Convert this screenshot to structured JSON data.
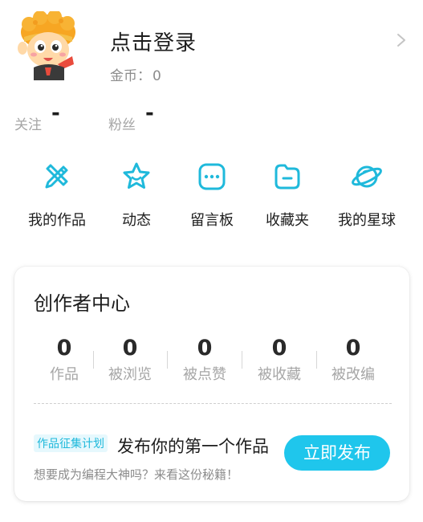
{
  "profile": {
    "login_text": "点击登录",
    "coins_label": "金币：",
    "coins_value": "0"
  },
  "stats": {
    "follow_label": "关注",
    "follow_value": "-",
    "fans_label": "粉丝",
    "fans_value": "-"
  },
  "menu": [
    {
      "label": "我的作品",
      "icon": "pencil-icon"
    },
    {
      "label": "动态",
      "icon": "star-icon"
    },
    {
      "label": "留言板",
      "icon": "message-icon"
    },
    {
      "label": "收藏夹",
      "icon": "folder-icon"
    },
    {
      "label": "我的星球",
      "icon": "planet-icon"
    }
  ],
  "creator": {
    "title": "创作者中心",
    "metrics": [
      {
        "value": "0",
        "label": "作品"
      },
      {
        "value": "0",
        "label": "被浏览"
      },
      {
        "value": "0",
        "label": "被点赞"
      },
      {
        "value": "0",
        "label": "被收藏"
      },
      {
        "value": "0",
        "label": "被改编"
      }
    ],
    "tag": "作品征集计划",
    "promo_title": "发布你的第一个作品",
    "promo_sub": "想要成为编程大神吗？来看这份秘籍！",
    "publish_button": "立即发布"
  },
  "colors": {
    "accent": "#1fc6ec",
    "icon_blue": "#1fb9db",
    "muted_text": "#a6a6a6"
  }
}
